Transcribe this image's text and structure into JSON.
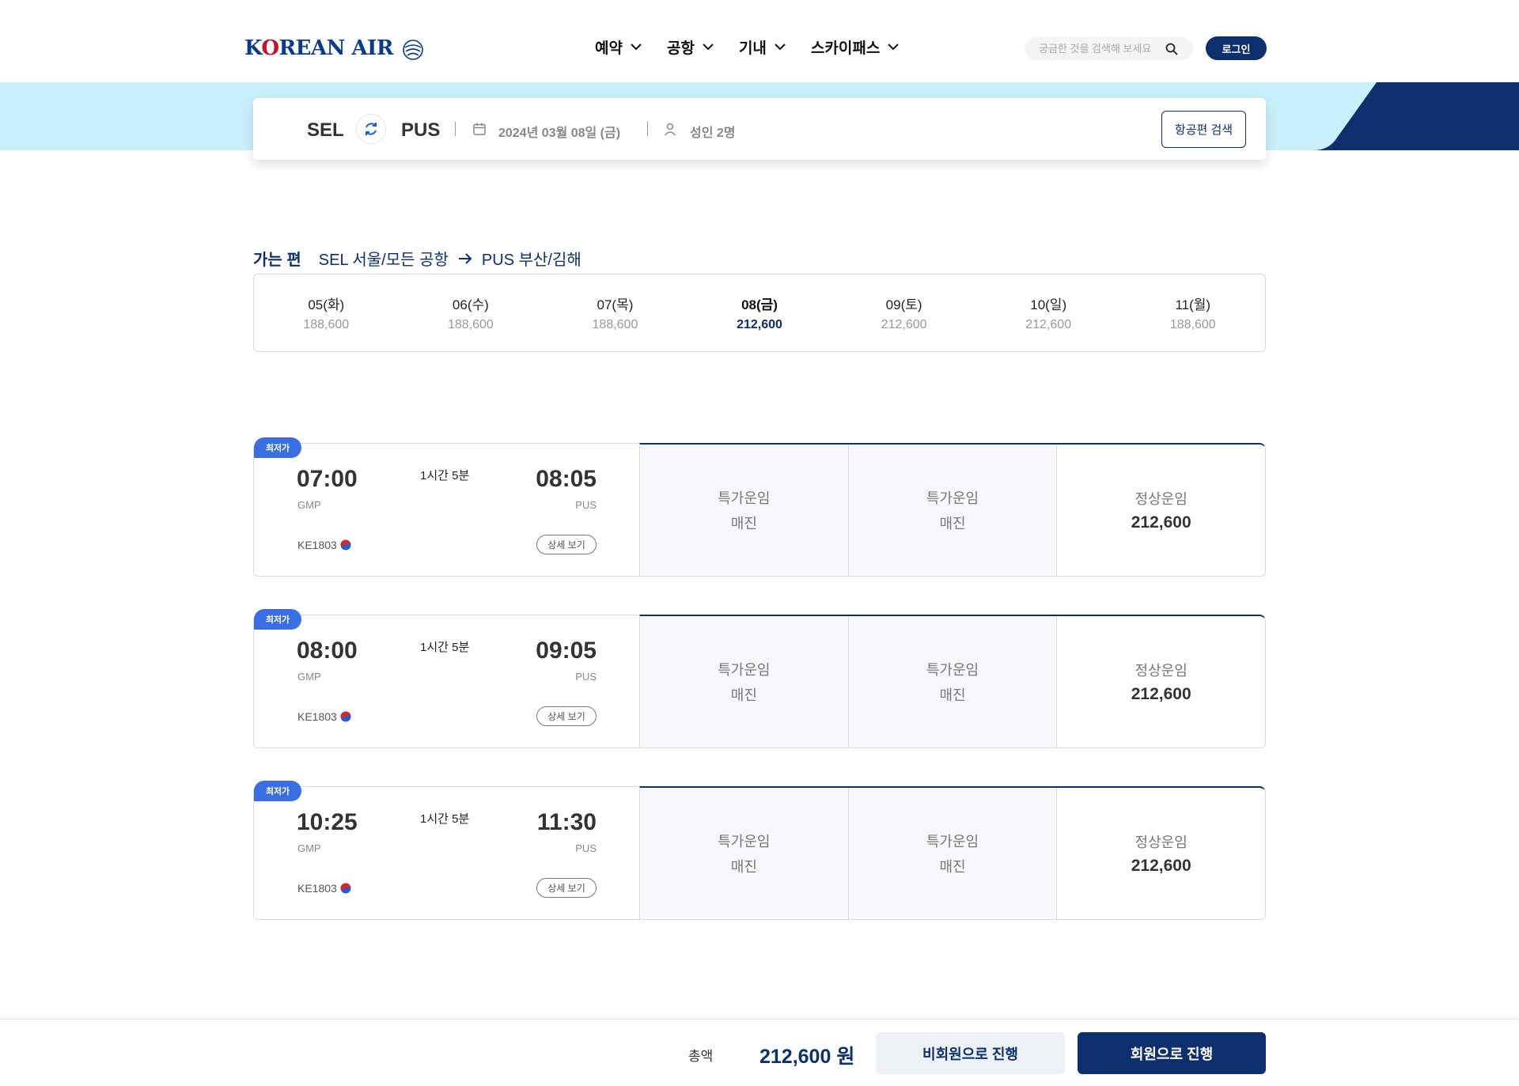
{
  "header": {
    "logo_text_k": "K",
    "logo_text_o": "O",
    "logo_text_rest": "REAN AIR",
    "nav": [
      {
        "label": "예약"
      },
      {
        "label": "공항"
      },
      {
        "label": "기내"
      },
      {
        "label": "스카이패스"
      }
    ],
    "search_placeholder": "궁금한 것을 검색해 보세요",
    "login_label": "로그인"
  },
  "summary": {
    "from": "SEL",
    "to": "PUS",
    "date": "2024년 03월 08일 (금)",
    "passengers": "성인 2명",
    "search_button": "항공편 검색"
  },
  "route": {
    "tag": "가는 편",
    "from": "SEL 서울/모든 공항",
    "to": "PUS 부산/김해"
  },
  "dates": [
    {
      "day": "05(화)",
      "price": "188,600",
      "active": false
    },
    {
      "day": "06(수)",
      "price": "188,600",
      "active": false
    },
    {
      "day": "07(목)",
      "price": "188,600",
      "active": false
    },
    {
      "day": "08(금)",
      "price": "212,600",
      "active": true
    },
    {
      "day": "09(토)",
      "price": "212,600",
      "active": false
    },
    {
      "day": "10(일)",
      "price": "212,600",
      "active": false
    },
    {
      "day": "11(월)",
      "price": "188,600",
      "active": false
    }
  ],
  "flights": [
    {
      "badge": "최저가",
      "dep_time": "07:00",
      "dep_airport": "GMP",
      "duration": "1시간 5분",
      "arr_time": "08:05",
      "arr_airport": "PUS",
      "flight_no": "KE1803",
      "detail_label": "상세 보기",
      "fares": [
        {
          "name": "특가운임",
          "value": "매진"
        },
        {
          "name": "특가운임",
          "value": "매진"
        },
        {
          "name": "정상운임",
          "value": "212,600"
        }
      ]
    },
    {
      "badge": "최저가",
      "dep_time": "08:00",
      "dep_airport": "GMP",
      "duration": "1시간 5분",
      "arr_time": "09:05",
      "arr_airport": "PUS",
      "flight_no": "KE1803",
      "detail_label": "상세 보기",
      "fares": [
        {
          "name": "특가운임",
          "value": "매진"
        },
        {
          "name": "특가운임",
          "value": "매진"
        },
        {
          "name": "정상운임",
          "value": "212,600"
        }
      ]
    },
    {
      "badge": "최저가",
      "dep_time": "10:25",
      "dep_airport": "GMP",
      "duration": "1시간 5분",
      "arr_time": "11:30",
      "arr_airport": "PUS",
      "flight_no": "KE1803",
      "detail_label": "상세 보기",
      "fares": [
        {
          "name": "특가운임",
          "value": "매진"
        },
        {
          "name": "특가운임",
          "value": "매진"
        },
        {
          "name": "정상운임",
          "value": "212,600"
        }
      ]
    }
  ],
  "bottom": {
    "total_label": "총액",
    "total_amount": "212,600 원",
    "guest_button": "비회원으로 진행",
    "member_button": "회원으로 진행"
  },
  "colors": {
    "brand_navy": "#0d2f6e",
    "badge_blue": "#3a6fe3",
    "banner_sky": "#c9effa"
  }
}
